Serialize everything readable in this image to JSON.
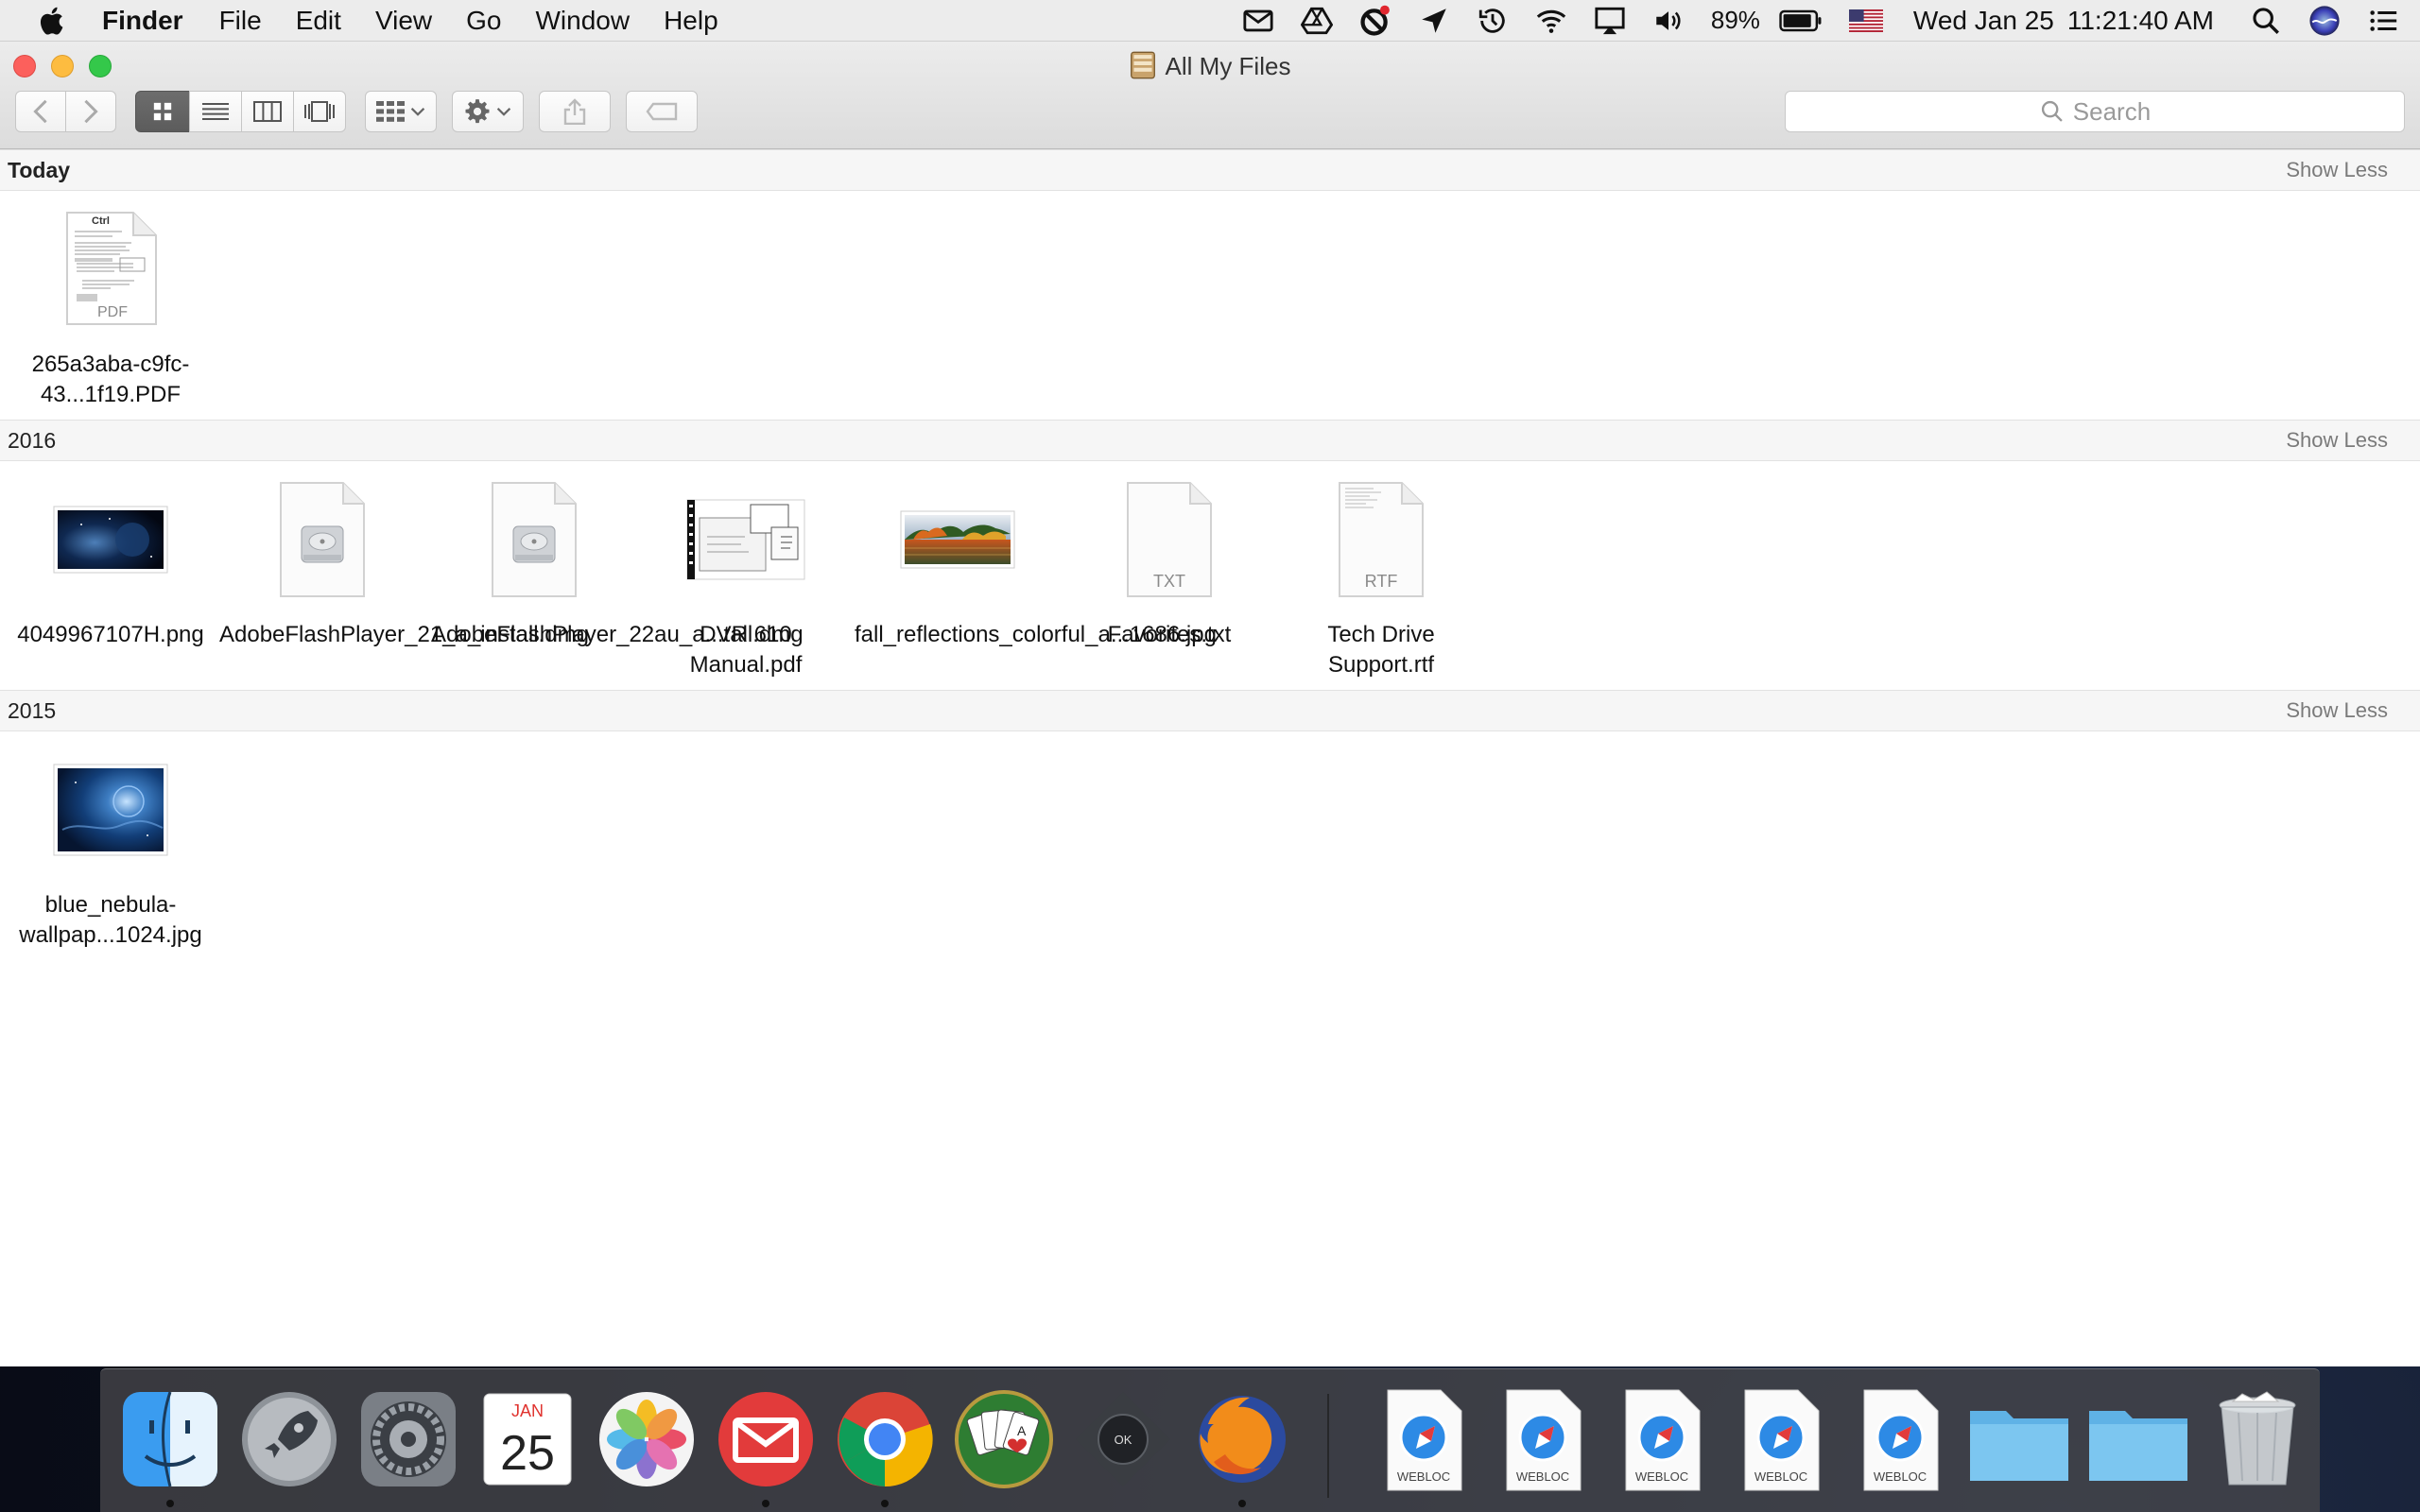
{
  "menubar": {
    "app_name": "Finder",
    "items": [
      "File",
      "Edit",
      "View",
      "Go",
      "Window",
      "Help"
    ],
    "battery_percent": "89%",
    "date": "Wed Jan 25",
    "time": "11:21:40 AM"
  },
  "window": {
    "title": "All My Files",
    "search_placeholder": "Search"
  },
  "sections": [
    {
      "title": "Today",
      "action": "Show Less",
      "files": [
        {
          "name": "265a3aba-c9fc-43...1f19.PDF",
          "kind": "pdf-doc",
          "badge": "PDF"
        }
      ]
    },
    {
      "title": "2016",
      "action": "Show Less",
      "files": [
        {
          "name": "4049967107H.png",
          "kind": "space-image"
        },
        {
          "name": "AdobeFlashPlayer_21_a_install.dmg",
          "kind": "disk-image"
        },
        {
          "name": "AdobeFlashPlayer_22au_a...tall.dmg",
          "kind": "disk-image"
        },
        {
          "name": "DVR 610 Manual.pdf",
          "kind": "manual-doc"
        },
        {
          "name": "fall_reflections_colorful_a...1686.jpg",
          "kind": "autumn-image"
        },
        {
          "name": "Favorites.txt",
          "kind": "text-doc",
          "badge": "TXT"
        },
        {
          "name": "Tech Drive Support.rtf",
          "kind": "text-doc",
          "badge": "RTF"
        }
      ]
    },
    {
      "title": "2015",
      "action": "Show Less",
      "files": [
        {
          "name": "blue_nebula-wallpap...1024.jpg",
          "kind": "nebula-image"
        }
      ]
    }
  ],
  "dock": {
    "calendar_month": "JAN",
    "calendar_day": "25",
    "webloc_label": "WEBLOC",
    "solitaire_card": "A",
    "remote_label": "OK"
  },
  "colors": {
    "accent_close": "#fc605c",
    "accent_min": "#fdbc40",
    "accent_max": "#34c84a",
    "folder_blue": "#7cc6f0"
  }
}
